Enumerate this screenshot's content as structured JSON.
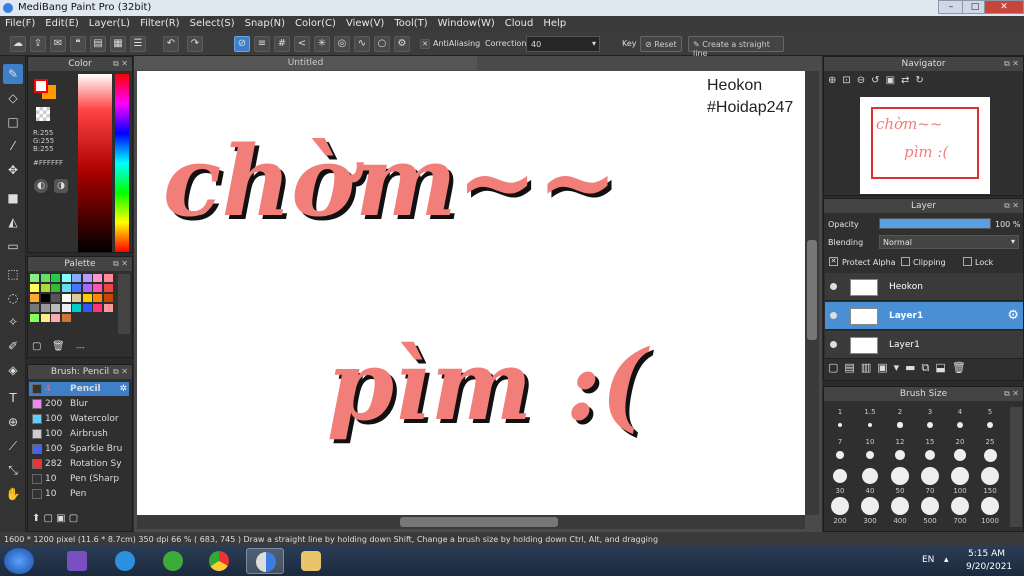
{
  "window": {
    "title": "MediBang Paint Pro (32bit)",
    "min": "–",
    "max": "□",
    "close": "✕"
  },
  "menu": [
    "File(F)",
    "Edit(E)",
    "Layer(L)",
    "Filter(R)",
    "Select(S)",
    "Snap(N)",
    "Color(C)",
    "View(V)",
    "Tool(T)",
    "Window(W)",
    "Cloud",
    "Help"
  ],
  "toolbar": {
    "antialiasing_label": "AntiAliasing",
    "correction_label": "Correction",
    "correction_value": "40",
    "key_label": "Key",
    "reset_label": "Reset",
    "straight_line_label": "Create a straight line"
  },
  "color_panel": {
    "title": "Color",
    "r": "R:255",
    "g": "G:255",
    "b": "B:255",
    "hex": "#FFFFFF",
    "fg_color": "#ff0000",
    "bg_color": "#ff9900"
  },
  "palette_panel": {
    "title": "Palette",
    "menu_label": "---",
    "swatches": [
      "#88ee88",
      "#66dd66",
      "#22cc44",
      "#88ffff",
      "#88aaff",
      "#bb99ff",
      "#ff99cc",
      "#ff8899",
      "#ffff55",
      "#aadd33",
      "#33bb33",
      "#66ddee",
      "#4477ff",
      "#aa66ff",
      "#ff55aa",
      "#ee4444",
      "#ffaa33",
      "#000000",
      "#555555",
      "#ffffff",
      "#ddcc99",
      "#ffcc00",
      "#ff8800",
      "#cc4400",
      "#777777",
      "#999999",
      "#bbbbbb",
      "#eeeeee",
      "#00cccc",
      "#3355ff",
      "#ff3377",
      "#ff9999",
      "#88ff55",
      "#ffee88",
      "#ffaaaa",
      "#cc7733"
    ]
  },
  "brush_panel": {
    "title": "Brush: Pencil",
    "items": [
      {
        "size": "4",
        "name": "Pencil",
        "color": "#333333",
        "selected": true
      },
      {
        "size": "200",
        "name": "Blur",
        "color": "#ee88ee"
      },
      {
        "size": "100",
        "name": "Watercolor",
        "color": "#66ccff"
      },
      {
        "size": "100",
        "name": "Airbrush",
        "color": "#cccccc"
      },
      {
        "size": "100",
        "name": "Sparkle Bru",
        "color": "#4466ee"
      },
      {
        "size": "282",
        "name": "Rotation Sy",
        "color": "#ee3333"
      },
      {
        "size": "10",
        "name": "Pen (Sharp",
        "color": "#333333"
      },
      {
        "size": "10",
        "name": "Pen",
        "color": "#333333"
      }
    ]
  },
  "canvas": {
    "tab_title": "Untitled",
    "author": "Heokon",
    "hashtag": "#Hoidap247",
    "text_line1": "chờm~~",
    "text_line2": "pìm :("
  },
  "navigator": {
    "title": "Navigator"
  },
  "layer_panel": {
    "title": "Layer",
    "opacity_label": "Opacity",
    "opacity_value": "100 %",
    "opacity_fraction": 1.0,
    "blending_label": "Blending",
    "blending_value": "Normal",
    "protect_alpha": "Protect Alpha",
    "clipping": "Clipping",
    "lock": "Lock",
    "layers": [
      {
        "name": "Heokon",
        "selected": false
      },
      {
        "name": "Layer1",
        "selected": true
      },
      {
        "name": "Layer1",
        "selected": false
      }
    ]
  },
  "brush_size_panel": {
    "title": "Brush Size",
    "sizes": [
      "1",
      "1.5",
      "2",
      "3",
      "4",
      "5",
      "7",
      "10",
      "12",
      "15",
      "20",
      "25",
      "30",
      "40",
      "50",
      "70",
      "100",
      "150",
      "200",
      "300",
      "400",
      "500",
      "700",
      "1000"
    ]
  },
  "status": {
    "text": "1600 * 1200 pixel   (11.6 * 8.7cm)   350 dpi   66 %   ( 683, 745 )   Draw a straight line by holding down Shift, Change a brush size by holding down Ctrl, Alt, and dragging"
  },
  "taskbar": {
    "lang": "EN",
    "time": "5:15 AM",
    "date": "9/20/2021"
  }
}
